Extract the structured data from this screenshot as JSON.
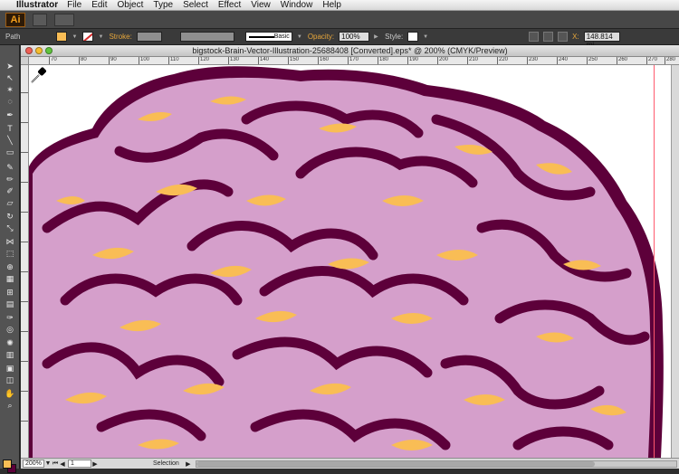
{
  "menubar": {
    "app_name": "Illustrator",
    "items": [
      "File",
      "Edit",
      "Object",
      "Type",
      "Select",
      "Effect",
      "View",
      "Window",
      "Help"
    ]
  },
  "appbar": {
    "logo": "Ai"
  },
  "control_bar": {
    "selection_type": "Path",
    "stroke_label": "Stroke:",
    "brush_label": "Basic",
    "opacity_label": "Opacity:",
    "opacity_value": "100%",
    "style_label": "Style:",
    "x_label": "X:",
    "x_value": "148.814 mi"
  },
  "document": {
    "title": "bigstock-Brain-Vector-Illustration-25688408 [Converted].eps* @ 200% (CMYK/Preview)",
    "ruler_labels": [
      "70",
      "80",
      "90",
      "100",
      "110",
      "120",
      "130",
      "140",
      "150",
      "160",
      "170",
      "180",
      "190",
      "200",
      "210",
      "220",
      "230",
      "240",
      "250",
      "260",
      "270",
      "280"
    ]
  },
  "statusbar": {
    "zoom": "200%",
    "page": "1",
    "tool": "Selection"
  },
  "colors": {
    "brain_outline": "#5d003a",
    "brain_fill": "#d59fcb",
    "brain_highlight": "#f9bd55",
    "guide": "#ff5a6e"
  },
  "icons": {
    "cursor": "eyedropper-icon"
  }
}
